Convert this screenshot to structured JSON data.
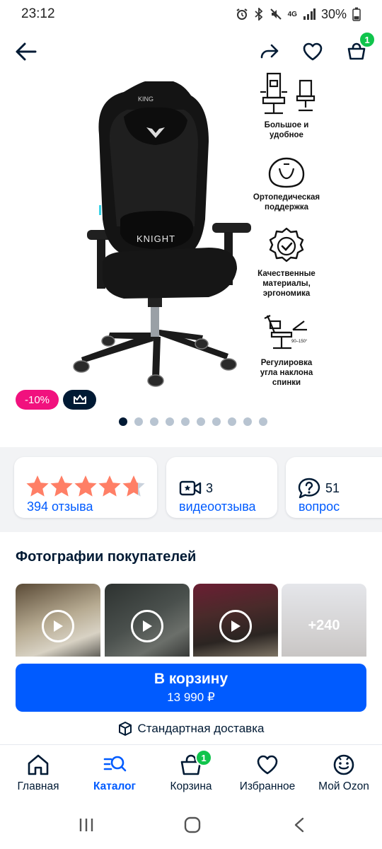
{
  "status_bar": {
    "time": "23:12",
    "network": "4G",
    "battery": "30%"
  },
  "top_bar": {
    "icons": [
      "back-arrow-icon",
      "share-icon",
      "heart-icon",
      "cart-icon"
    ],
    "cart_badge": "1"
  },
  "gallery": {
    "chair_logo_text": "KNIGHT",
    "chair_headrest_text": "KING",
    "features": [
      {
        "icon": "chair-size-icon",
        "label": "Большое и удобное"
      },
      {
        "icon": "pillow-icon",
        "label": "Ортопедическая поддержка"
      },
      {
        "icon": "quality-check-icon",
        "label": "Качественные материалы, эргономика"
      },
      {
        "icon": "recline-icon",
        "label": "Регулировка угла наклона спинки",
        "angle_note": "90–150°"
      }
    ],
    "discount_badge": "-10%",
    "premium_icon": "crown-icon",
    "dots_total": 10,
    "dots_active_index": 0
  },
  "reviews": {
    "rating": 4.7,
    "rating_max": 5,
    "reviews_count_label": "394 отзыва",
    "video_count": "3",
    "video_label": "видеоотзыва",
    "questions_count": "51",
    "questions_label": "вопрос"
  },
  "customer_photos": {
    "title": "Фотографии покупателей",
    "items": [
      {
        "type": "video"
      },
      {
        "type": "video"
      },
      {
        "type": "video"
      },
      {
        "type": "more",
        "label": "+240"
      }
    ]
  },
  "purchase": {
    "button_label": "В корзину",
    "price": "13 990 ₽",
    "delivery": "Стандартная доставка"
  },
  "bottom_nav": {
    "items": [
      {
        "label": "Главная",
        "icon": "home-icon"
      },
      {
        "label": "Каталог",
        "icon": "catalog-search-icon",
        "active": true
      },
      {
        "label": "Корзина",
        "icon": "basket-icon",
        "badge": "1"
      },
      {
        "label": "Избранное",
        "icon": "heart-icon"
      },
      {
        "label": "Мой Ozon",
        "icon": "profile-smile-icon"
      }
    ]
  },
  "colors": {
    "accent": "#005bff",
    "discount": "#f1117e",
    "badge_green": "#10c44c",
    "star": "#ff7f66",
    "text": "#001a34"
  }
}
